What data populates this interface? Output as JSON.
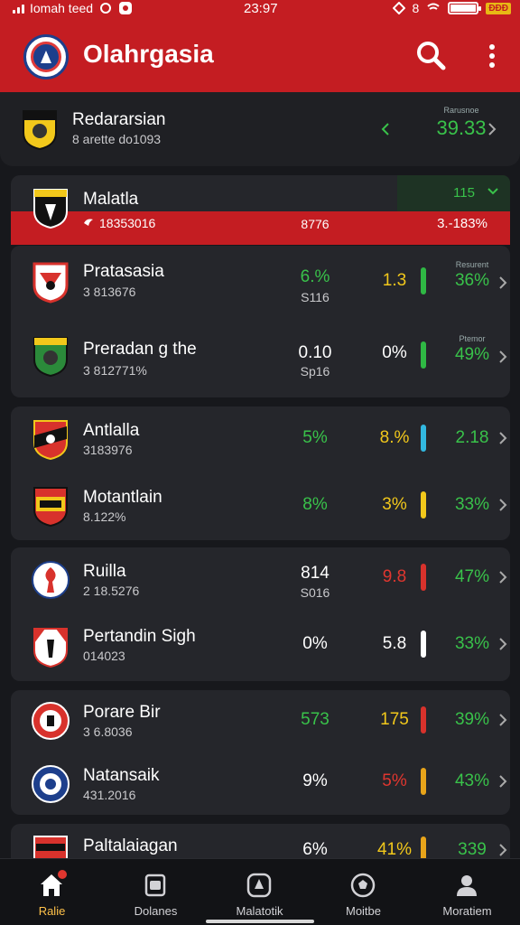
{
  "status_bar": {
    "carrier": "Iomah teed",
    "time": "23:97",
    "indicator": "8",
    "battery_badge": "ĐĐĐ"
  },
  "app_bar": {
    "title": "Olahrgasia",
    "icons": [
      "shield-logo-icon",
      "search-icon",
      "more-vert-icon"
    ]
  },
  "colors": {
    "header": "#c41d22",
    "background": "#17181c",
    "card": "#25262b",
    "green": "#39c24a",
    "yellow": "#f2c81b",
    "red": "#e0362f"
  },
  "top_row": {
    "name": "Redararsian",
    "sub": "8 arette do1093",
    "pct_label": "Rarusnoe",
    "pct": "39.33"
  },
  "highlight_row": {
    "name": "Malatla",
    "sub": "18353016",
    "dropdown_value": "115",
    "v1": "8776",
    "pct": "3.-183%"
  },
  "groups": [
    {
      "rows": [
        {
          "name": "Pratasasia",
          "sub": "3 813676",
          "v1": "6.%",
          "v1_sub": "S116",
          "v2": "1.3",
          "pct": "36%",
          "pct_label": "Resurent"
        },
        {
          "name": "Preradan g the",
          "sub": "3 812771%",
          "v1": "0.10",
          "v1_sub": "Sp16",
          "v2": "0%",
          "pct": "49%",
          "pct_label": "Ptemor"
        }
      ]
    },
    {
      "rows": [
        {
          "name": "Antlalla",
          "sub": "3183976",
          "v1": "5%",
          "v2": "8.%",
          "pct": "2.18"
        },
        {
          "name": "Motantlain",
          "sub": "8.122%",
          "v1": "8%",
          "v2": "3%",
          "pct": "33%"
        }
      ]
    },
    {
      "rows": [
        {
          "name": "Ruilla",
          "sub": "2 18.5276",
          "v1": "814",
          "v1_sub": "S016",
          "v2": "9.8",
          "pct": "47%"
        },
        {
          "name": "Pertandin Sigh",
          "sub": "014023",
          "v1": "0%",
          "v2": "5.8",
          "pct": "33%"
        }
      ]
    },
    {
      "rows": [
        {
          "name": "Porare Bir",
          "sub": "3 6.8036",
          "v1": "573",
          "v2": "175",
          "pct": "39%"
        },
        {
          "name": "Natansaik",
          "sub": "431.2016",
          "v1": "9%",
          "v2": "5%",
          "pct": "43%"
        }
      ]
    },
    {
      "rows": [
        {
          "name": "Paltalaiagan",
          "v1": "6%",
          "v2": "41%",
          "pct": "339"
        }
      ]
    }
  ],
  "bottom_nav": [
    {
      "label": "Ralie",
      "icon": "home-icon"
    },
    {
      "label": "Dolanes",
      "icon": "calendar-icon"
    },
    {
      "label": "Malatotik",
      "icon": "badge-icon"
    },
    {
      "label": "Moitbe",
      "icon": "ball-icon"
    },
    {
      "label": "Moratiem",
      "icon": "profile-icon"
    }
  ]
}
